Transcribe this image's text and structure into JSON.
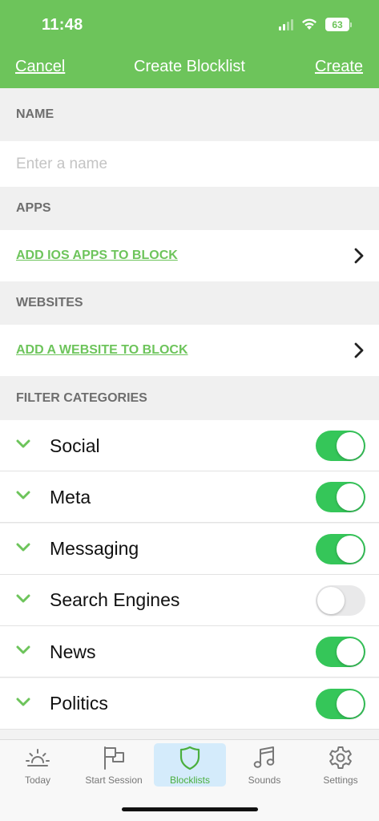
{
  "status_bar": {
    "time": "11:48",
    "battery": "63"
  },
  "nav": {
    "cancel": "Cancel",
    "title": "Create Blocklist",
    "create": "Create"
  },
  "name_section": {
    "header": "NAME",
    "placeholder": "Enter a name",
    "value": ""
  },
  "apps_section": {
    "header": "APPS",
    "link": "ADD IOS APPS TO BLOCK"
  },
  "websites_section": {
    "header": "WEBSITES",
    "link": "ADD A WEBSITE TO BLOCK"
  },
  "filter_section": {
    "header": "FILTER CATEGORIES",
    "items": [
      {
        "label": "Social",
        "enabled": true
      },
      {
        "label": "Meta",
        "enabled": true
      },
      {
        "label": "Messaging",
        "enabled": true
      },
      {
        "label": "Search Engines",
        "enabled": false
      },
      {
        "label": "News",
        "enabled": true
      },
      {
        "label": "Politics",
        "enabled": true
      }
    ]
  },
  "tabbar": {
    "tabs": [
      {
        "label": "Today",
        "icon": "sunrise-icon",
        "active": false
      },
      {
        "label": "Start Session",
        "icon": "flag-icon",
        "active": false
      },
      {
        "label": "Blocklists",
        "icon": "shield-icon",
        "active": true
      },
      {
        "label": "Sounds",
        "icon": "music-note-icon",
        "active": false
      },
      {
        "label": "Settings",
        "icon": "gear-icon",
        "active": false
      }
    ]
  },
  "colors": {
    "brand_green": "#6dc45b",
    "toggle_on": "#35c659",
    "toggle_off": "#e9e9ea",
    "active_tab_bg": "#d4ebfb"
  }
}
